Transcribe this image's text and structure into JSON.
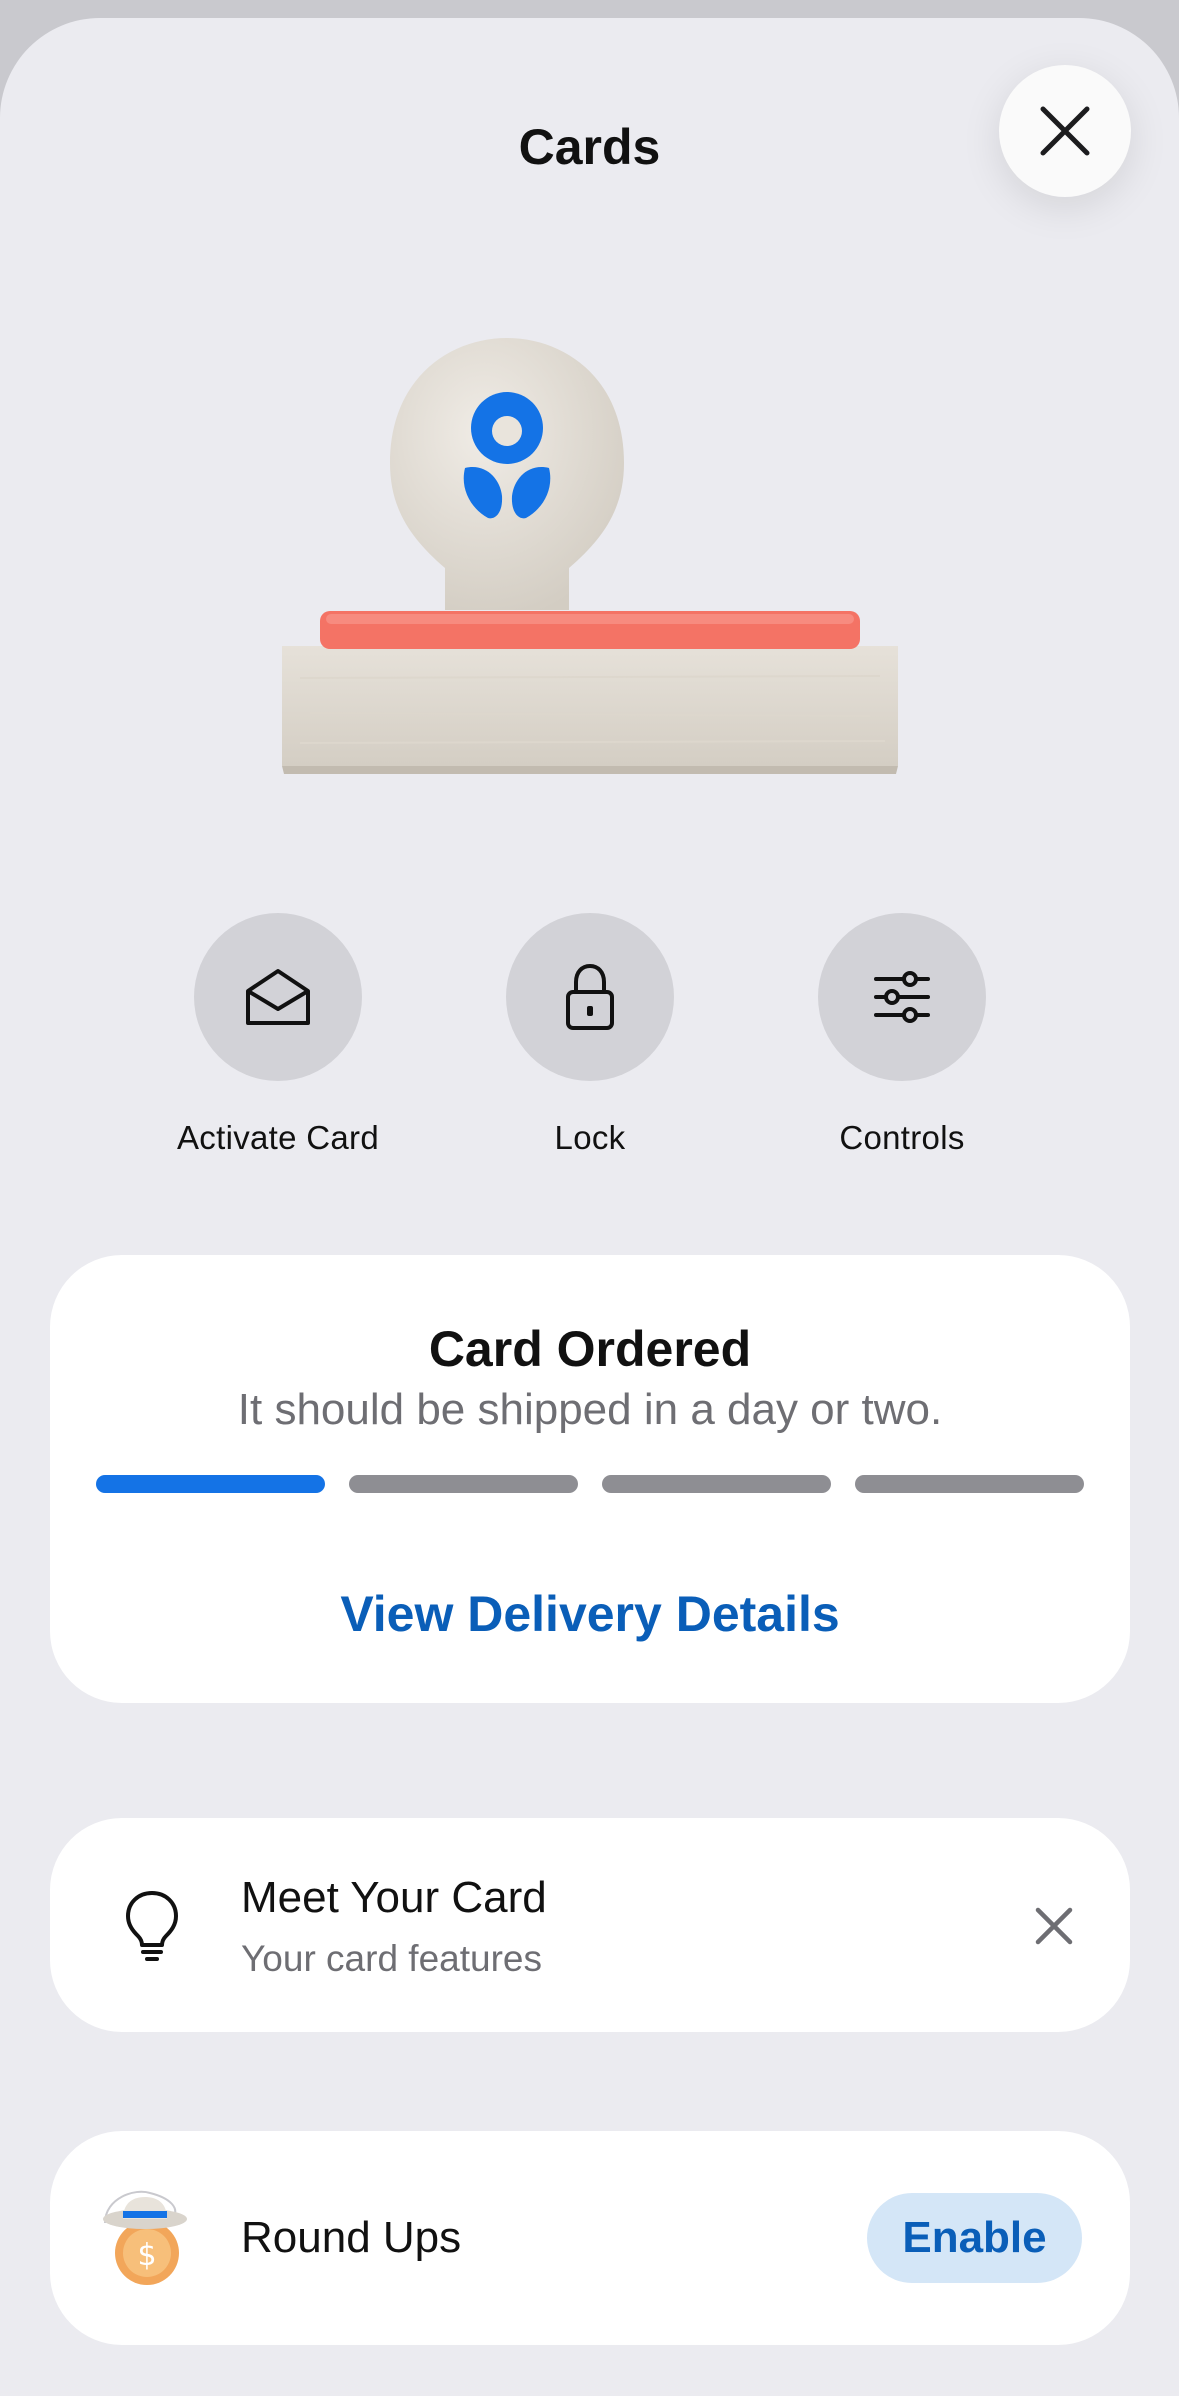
{
  "header": {
    "title": "Cards"
  },
  "actions": [
    {
      "label": "Activate Card",
      "icon": "envelope-open-icon"
    },
    {
      "label": "Lock",
      "icon": "lock-icon"
    },
    {
      "label": "Controls",
      "icon": "sliders-icon"
    }
  ],
  "card_status": {
    "title": "Card Ordered",
    "subtitle": "It should be shipped in a day or two.",
    "progress_steps_total": 4,
    "progress_steps_complete": 1,
    "link_label": "View Delivery Details",
    "active_color": "#1473e6",
    "inactive_color": "#8e8e93"
  },
  "tip": {
    "title": "Meet Your Card",
    "subtitle": "Your card features",
    "icon": "lightbulb-icon"
  },
  "roundups": {
    "label": "Round Ups",
    "button_label": "Enable",
    "icon": "coin-cowboy-hat-icon"
  },
  "colors": {
    "accent": "#0a5eb8",
    "stamp_pad": "#f47365",
    "brand_blue": "#1473e6"
  }
}
